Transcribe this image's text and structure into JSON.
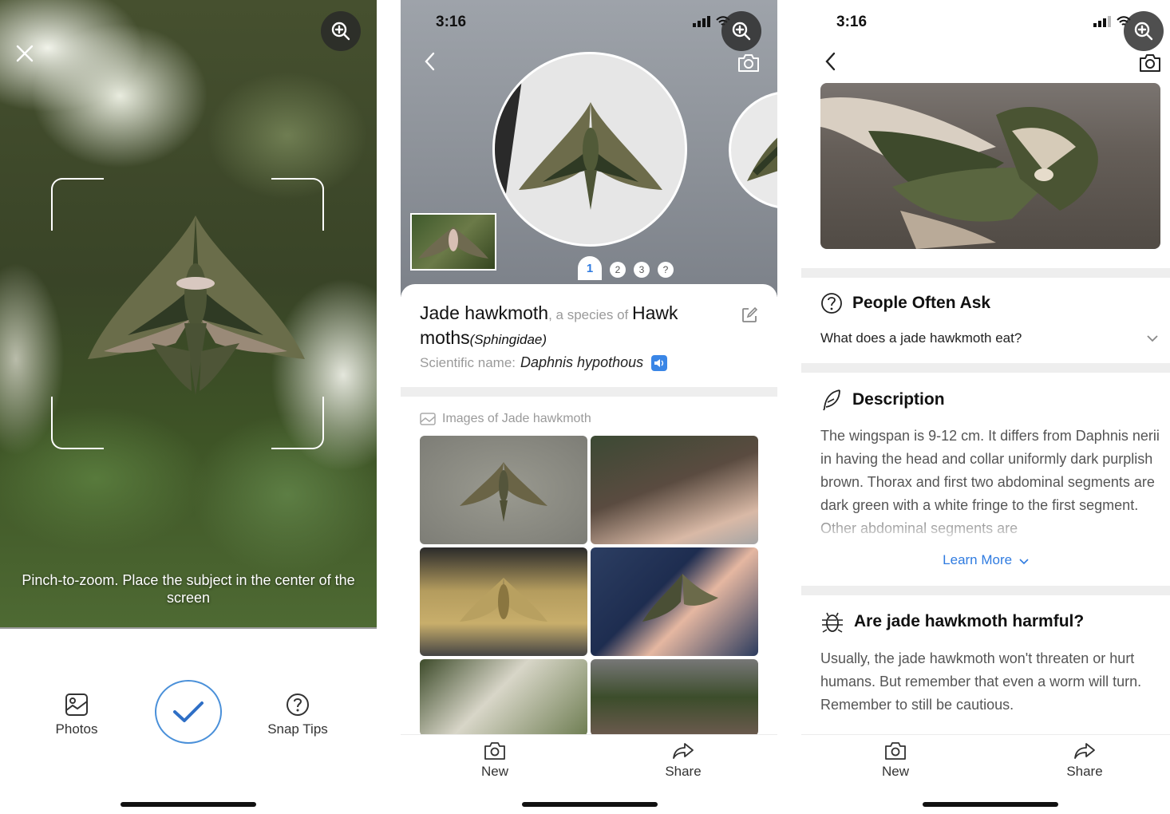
{
  "camera_screen": {
    "hint": "Pinch-to-zoom. Place the subject in the center of the screen",
    "photos_label": "Photos",
    "snap_tips_label": "Snap Tips"
  },
  "status_bar": {
    "time": "3:16"
  },
  "result_screen": {
    "common_name": "Jade hawkmoth",
    "species_connector": ", a species of ",
    "genus_common": "Hawk moths",
    "family": "(Sphingidae)",
    "scientific_label": "Scientific name:",
    "scientific_name": "Daphnis hypothous",
    "pager": [
      "1",
      "2",
      "3",
      "?"
    ],
    "images_heading": "Images of Jade hawkmoth"
  },
  "detail_screen": {
    "people_often_ask": {
      "title": "People Often Ask",
      "question": "What does a jade hawkmoth eat?"
    },
    "description": {
      "title": "Description",
      "text": "The wingspan is 9-12 cm. It differs from Daphnis nerii in having the head and collar uniformly dark purplish brown. Thorax and first two abdominal segments are dark green with a white fringe to the first segment. Other abdominal segments are",
      "learn_more": "Learn More"
    },
    "harmful": {
      "title": "Are jade hawkmoth harmful?",
      "text": "Usually, the jade hawkmoth won't threaten or hurt humans. But remember that even a worm will turn. Remember to still be cautious."
    }
  },
  "tabbar": {
    "new_label": "New",
    "share_label": "Share"
  },
  "colors": {
    "accent": "#2f7be0",
    "shutter_ring": "#4a90d9"
  },
  "icons": [
    "close-icon",
    "zoom-in-icon",
    "photos-icon",
    "checkmark-icon",
    "question-icon",
    "back-icon",
    "camera-icon",
    "edit-icon",
    "speaker-icon",
    "image-icon",
    "feather-icon",
    "bug-icon",
    "chevron-down-icon",
    "share-icon",
    "signal-icon",
    "wifi-icon"
  ]
}
